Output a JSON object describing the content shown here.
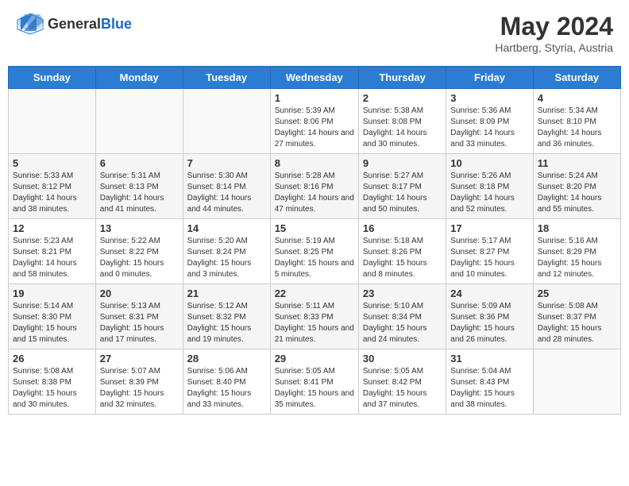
{
  "header": {
    "logo_general": "General",
    "logo_blue": "Blue",
    "title": "May 2024",
    "subtitle": "Hartberg, Styria, Austria"
  },
  "days_of_week": [
    "Sunday",
    "Monday",
    "Tuesday",
    "Wednesday",
    "Thursday",
    "Friday",
    "Saturday"
  ],
  "weeks": [
    [
      {
        "day": "",
        "info": ""
      },
      {
        "day": "",
        "info": ""
      },
      {
        "day": "",
        "info": ""
      },
      {
        "day": "1",
        "info": "Sunrise: 5:39 AM\nSunset: 8:06 PM\nDaylight: 14 hours and 27 minutes."
      },
      {
        "day": "2",
        "info": "Sunrise: 5:38 AM\nSunset: 8:08 PM\nDaylight: 14 hours and 30 minutes."
      },
      {
        "day": "3",
        "info": "Sunrise: 5:36 AM\nSunset: 8:09 PM\nDaylight: 14 hours and 33 minutes."
      },
      {
        "day": "4",
        "info": "Sunrise: 5:34 AM\nSunset: 8:10 PM\nDaylight: 14 hours and 36 minutes."
      }
    ],
    [
      {
        "day": "5",
        "info": "Sunrise: 5:33 AM\nSunset: 8:12 PM\nDaylight: 14 hours and 38 minutes."
      },
      {
        "day": "6",
        "info": "Sunrise: 5:31 AM\nSunset: 8:13 PM\nDaylight: 14 hours and 41 minutes."
      },
      {
        "day": "7",
        "info": "Sunrise: 5:30 AM\nSunset: 8:14 PM\nDaylight: 14 hours and 44 minutes."
      },
      {
        "day": "8",
        "info": "Sunrise: 5:28 AM\nSunset: 8:16 PM\nDaylight: 14 hours and 47 minutes."
      },
      {
        "day": "9",
        "info": "Sunrise: 5:27 AM\nSunset: 8:17 PM\nDaylight: 14 hours and 50 minutes."
      },
      {
        "day": "10",
        "info": "Sunrise: 5:26 AM\nSunset: 8:18 PM\nDaylight: 14 hours and 52 minutes."
      },
      {
        "day": "11",
        "info": "Sunrise: 5:24 AM\nSunset: 8:20 PM\nDaylight: 14 hours and 55 minutes."
      }
    ],
    [
      {
        "day": "12",
        "info": "Sunrise: 5:23 AM\nSunset: 8:21 PM\nDaylight: 14 hours and 58 minutes."
      },
      {
        "day": "13",
        "info": "Sunrise: 5:22 AM\nSunset: 8:22 PM\nDaylight: 15 hours and 0 minutes."
      },
      {
        "day": "14",
        "info": "Sunrise: 5:20 AM\nSunset: 8:24 PM\nDaylight: 15 hours and 3 minutes."
      },
      {
        "day": "15",
        "info": "Sunrise: 5:19 AM\nSunset: 8:25 PM\nDaylight: 15 hours and 5 minutes."
      },
      {
        "day": "16",
        "info": "Sunrise: 5:18 AM\nSunset: 8:26 PM\nDaylight: 15 hours and 8 minutes."
      },
      {
        "day": "17",
        "info": "Sunrise: 5:17 AM\nSunset: 8:27 PM\nDaylight: 15 hours and 10 minutes."
      },
      {
        "day": "18",
        "info": "Sunrise: 5:16 AM\nSunset: 8:29 PM\nDaylight: 15 hours and 12 minutes."
      }
    ],
    [
      {
        "day": "19",
        "info": "Sunrise: 5:14 AM\nSunset: 8:30 PM\nDaylight: 15 hours and 15 minutes."
      },
      {
        "day": "20",
        "info": "Sunrise: 5:13 AM\nSunset: 8:31 PM\nDaylight: 15 hours and 17 minutes."
      },
      {
        "day": "21",
        "info": "Sunrise: 5:12 AM\nSunset: 8:32 PM\nDaylight: 15 hours and 19 minutes."
      },
      {
        "day": "22",
        "info": "Sunrise: 5:11 AM\nSunset: 8:33 PM\nDaylight: 15 hours and 21 minutes."
      },
      {
        "day": "23",
        "info": "Sunrise: 5:10 AM\nSunset: 8:34 PM\nDaylight: 15 hours and 24 minutes."
      },
      {
        "day": "24",
        "info": "Sunrise: 5:09 AM\nSunset: 8:36 PM\nDaylight: 15 hours and 26 minutes."
      },
      {
        "day": "25",
        "info": "Sunrise: 5:08 AM\nSunset: 8:37 PM\nDaylight: 15 hours and 28 minutes."
      }
    ],
    [
      {
        "day": "26",
        "info": "Sunrise: 5:08 AM\nSunset: 8:38 PM\nDaylight: 15 hours and 30 minutes."
      },
      {
        "day": "27",
        "info": "Sunrise: 5:07 AM\nSunset: 8:39 PM\nDaylight: 15 hours and 32 minutes."
      },
      {
        "day": "28",
        "info": "Sunrise: 5:06 AM\nSunset: 8:40 PM\nDaylight: 15 hours and 33 minutes."
      },
      {
        "day": "29",
        "info": "Sunrise: 5:05 AM\nSunset: 8:41 PM\nDaylight: 15 hours and 35 minutes."
      },
      {
        "day": "30",
        "info": "Sunrise: 5:05 AM\nSunset: 8:42 PM\nDaylight: 15 hours and 37 minutes."
      },
      {
        "day": "31",
        "info": "Sunrise: 5:04 AM\nSunset: 8:43 PM\nDaylight: 15 hours and 38 minutes."
      },
      {
        "day": "",
        "info": ""
      }
    ]
  ]
}
